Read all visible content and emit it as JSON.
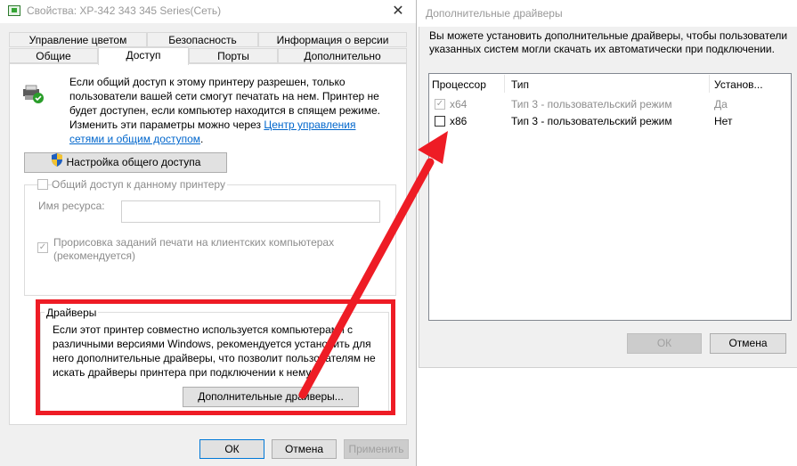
{
  "left_dialog": {
    "title": "Свойства: XP-342 343 345 Series(Сеть)",
    "close": "✕",
    "tabs_row1": [
      "Управление цветом",
      "Безопасность",
      "Информация о версии"
    ],
    "tabs_row2": [
      "Общие",
      "Доступ",
      "Порты",
      "Дополнительно"
    ],
    "active_tab": "Доступ",
    "info_line1": "Если общий доступ к этому принтеру разрешен, только",
    "info_line2": "пользователи вашей сети смогут печатать на нем. Принтер не",
    "info_line3": "будет доступен, если компьютер находится в спящем режиме.",
    "info_line4_prefix": "Изменить эти параметры можно через ",
    "info_link_part1": "Центр управления",
    "info_link_part2": "сетями и общим доступом",
    "info_line5_suffix": ".",
    "share_setup_button": "Настройка общего доступа",
    "share_checkbox_label": "Общий доступ к данному принтеру",
    "share_name_label": "Имя ресурса:",
    "share_name_value": "",
    "render_checkbox_line1": "Прорисовка заданий печати на клиентских компьютерах",
    "render_checkbox_line2": "(рекомендуется)",
    "drivers_group_title": "Драйверы",
    "drivers_text_line1": "Если этот принтер совместно используется компьютерами с",
    "drivers_text_line2": "различными версиями Windows, рекомендуется установить для",
    "drivers_text_line3": "него дополнительные драйверы, что позволит пользователям не",
    "drivers_text_line4": "искать драйверы принтера при подключении к нему.",
    "additional_drivers_button": "Дополнительные драйверы...",
    "ok_button": "ОК",
    "cancel_button": "Отмена",
    "apply_button": "Применить"
  },
  "right_dialog": {
    "title": "Дополнительные драйверы",
    "description_line1": "Вы можете установить дополнительные драйверы, чтобы пользователи",
    "description_line2": "указанных систем могли скачать их автоматически при подключении.",
    "columns": [
      "Процессор",
      "Тип",
      "Установ..."
    ],
    "rows": [
      {
        "processor": "x64",
        "type": "Тип 3 - пользовательский режим",
        "installed": "Да",
        "checked": true,
        "disabled": true
      },
      {
        "processor": "x86",
        "type": "Тип 3 - пользовательский режим",
        "installed": "Нет",
        "checked": false,
        "disabled": false
      }
    ],
    "ok_button": "ОК",
    "cancel_button": "Отмена"
  },
  "colors": {
    "annotation_red": "#ee1c25",
    "link_blue": "#0066cc",
    "focus_blue": "#0078d7"
  }
}
